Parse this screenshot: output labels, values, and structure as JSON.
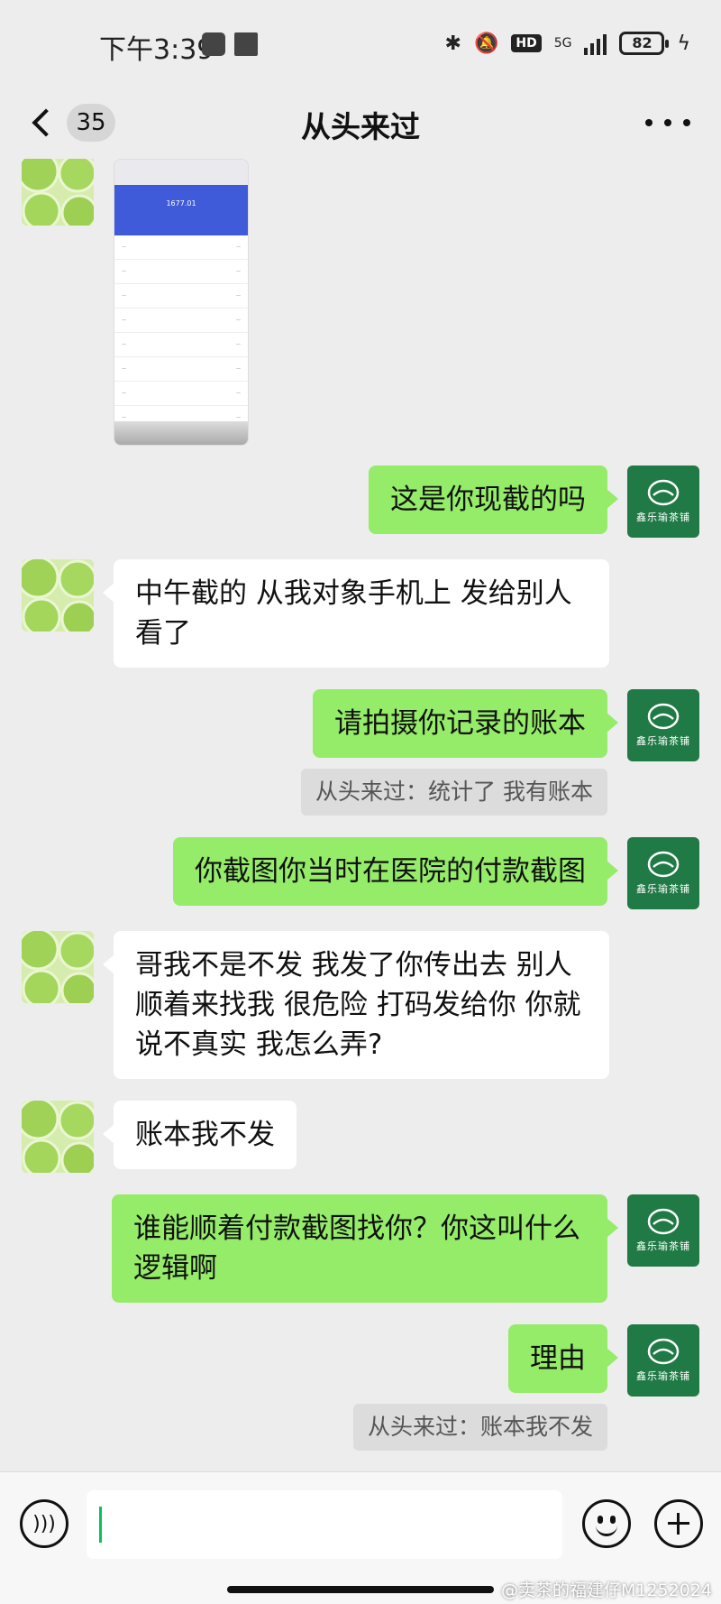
{
  "status_bar": {
    "time": "下午3:39",
    "network": "5G",
    "hd": "HD",
    "battery": "82"
  },
  "nav": {
    "unread_count": "35",
    "title": "从头来过"
  },
  "avatars": {
    "contact": "lime-slices-avatar",
    "me": {
      "shop_name": "鑫乐瑜茶铺"
    }
  },
  "messages": [
    {
      "side": "left",
      "type": "image"
    },
    {
      "side": "right",
      "text": "这是你现截的吗"
    },
    {
      "side": "left",
      "text": "中午截的 从我对象手机上 发给别人看了"
    },
    {
      "side": "right",
      "text": "请拍摄你记录的账本",
      "quote": "从头来过：统计了 我有账本"
    },
    {
      "side": "right",
      "text": "你截图你当时在医院的付款截图"
    },
    {
      "side": "left",
      "text": "哥我不是不发 我发了你传出去 别人顺着来找我 很危险 打码发给你 你就说不真实 我怎么弄?"
    },
    {
      "side": "left",
      "text": "账本我不发"
    },
    {
      "side": "right",
      "text": "谁能顺着付款截图找你？你这叫什么逻辑啊"
    },
    {
      "side": "right",
      "text": "理由",
      "quote": "从头来过：账本我不发"
    }
  ],
  "screenshot_thumb": {
    "amount": "1677.01"
  },
  "input": {
    "value": ""
  },
  "watermark": "@卖茶的福建仔M1252024",
  "colors": {
    "background": "#ededed",
    "bubble_self": "#95ec69",
    "bubble_other": "#ffffff",
    "avatar_shop": "#1f7a45"
  }
}
